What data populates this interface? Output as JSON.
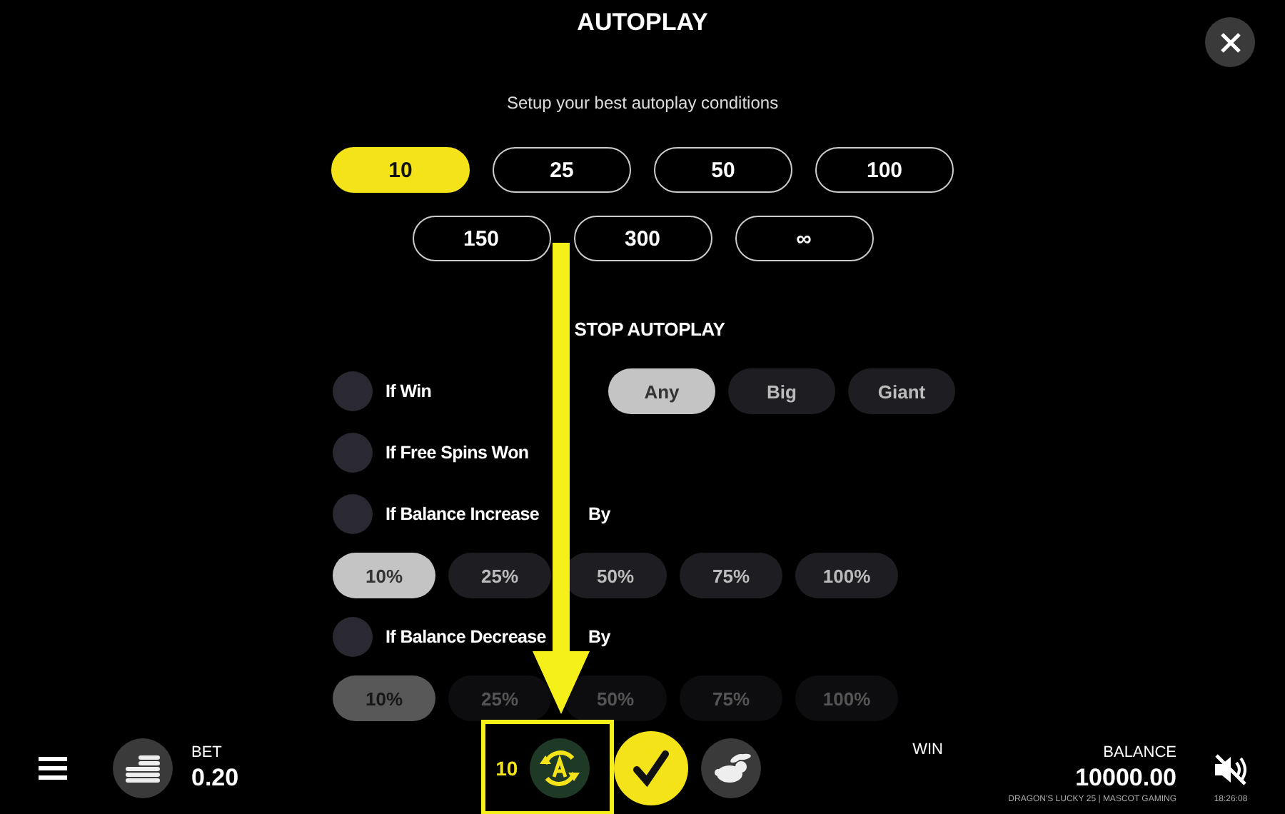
{
  "title": "AUTOPLAY",
  "subtitle": "Setup your best autoplay conditions",
  "spin_counts": [
    {
      "label": "10",
      "selected": true
    },
    {
      "label": "25",
      "selected": false
    },
    {
      "label": "50",
      "selected": false
    },
    {
      "label": "100",
      "selected": false
    },
    {
      "label": "150",
      "selected": false
    },
    {
      "label": "300",
      "selected": false
    },
    {
      "label": "∞",
      "selected": false
    }
  ],
  "stop_heading": "STOP AUTOPLAY",
  "conditions": [
    {
      "kind": "toggle",
      "label": "If Win",
      "on": false,
      "options": [
        {
          "label": "Any",
          "selected": true
        },
        {
          "label": "Big",
          "selected": false
        },
        {
          "label": "Giant",
          "selected": false
        }
      ]
    },
    {
      "kind": "toggle",
      "label": "If Free Spins Won",
      "on": false
    },
    {
      "kind": "toggle",
      "label": "If Balance Increase",
      "label_after": "By",
      "on": false
    },
    {
      "kind": "percent",
      "dimmed": false,
      "options": [
        {
          "label": "10%",
          "selected": true
        },
        {
          "label": "25%",
          "selected": false
        },
        {
          "label": "50%",
          "selected": false
        },
        {
          "label": "75%",
          "selected": false
        },
        {
          "label": "100%",
          "selected": false
        }
      ]
    },
    {
      "kind": "toggle",
      "label": "If Balance Decrease",
      "label_after": "By",
      "on": false
    },
    {
      "kind": "percent",
      "dimmed": true,
      "options": [
        {
          "label": "10%",
          "selected": true
        },
        {
          "label": "25%",
          "selected": false
        },
        {
          "label": "50%",
          "selected": false
        },
        {
          "label": "75%",
          "selected": false
        },
        {
          "label": "100%",
          "selected": false
        }
      ]
    }
  ],
  "bottom_bar": {
    "bet_label": "BET",
    "bet_value": "0.20",
    "autoplay_count": "10",
    "win_label": "WIN",
    "balance_label": "BALANCE",
    "balance_value": "10000.00",
    "game_info": "DRAGON'S LUCKY 25 | MASCOT GAMING",
    "time": "18:26:08"
  }
}
